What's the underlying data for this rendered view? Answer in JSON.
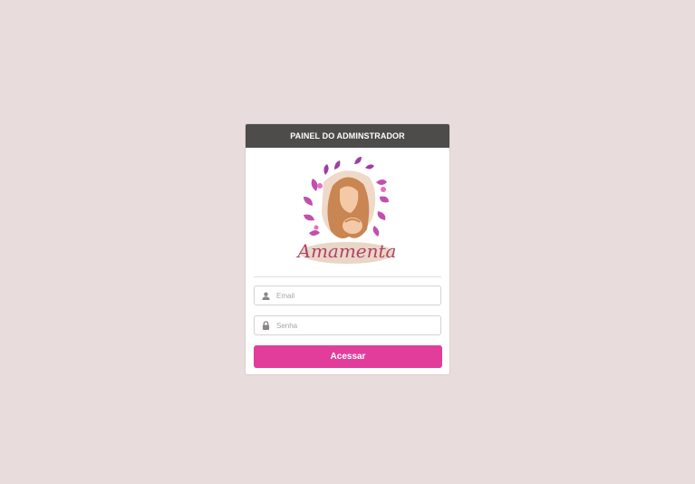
{
  "header": {
    "title": "PAINEL DO ADMINSTRADOR"
  },
  "logo": {
    "text": "Amamenta",
    "icon": "mother-breastfeeding-logo"
  },
  "form": {
    "email_placeholder": "Email",
    "email_value": "",
    "email_icon": "user-icon",
    "password_placeholder": "Senha",
    "password_value": "",
    "password_icon": "lock-icon",
    "submit_label": "Acessar"
  },
  "colors": {
    "background": "#e9dcdc",
    "header": "#4e4b4b",
    "accent": "#e23d9b",
    "card": "#ffffff"
  }
}
